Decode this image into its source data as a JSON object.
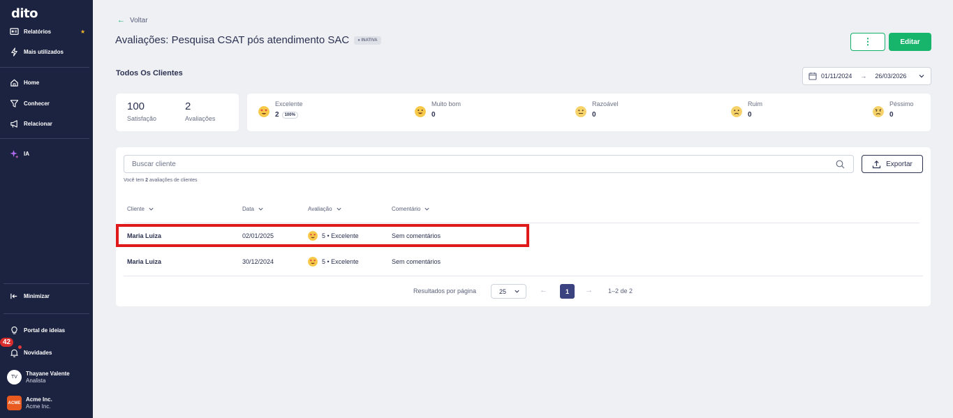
{
  "sidebar": {
    "logo": "dito",
    "items": {
      "relatorios": "Relatórios",
      "mais_utilizados": "Mais utilizados",
      "home": "Home",
      "conhecer": "Conhecer",
      "relacionar": "Relacionar",
      "ia": "IA",
      "minimizar": "Minimizar",
      "portal": "Portal de ideias",
      "novidades": "Novidades"
    },
    "favorite_star": "★",
    "notification_count": "42",
    "user": {
      "initials": "TV",
      "name": "Thayane Valente",
      "role": "Analista"
    },
    "company": {
      "logo_text": "ACME",
      "name": "Acme Inc.",
      "sub": "Acme Inc."
    }
  },
  "header": {
    "back_label": "Voltar",
    "title": "Avaliações: Pesquisa CSAT pós atendimento SAC",
    "status_badge": "● INATIVA",
    "more_button": "⋮",
    "edit_button": "Editar"
  },
  "filter": {
    "subtitle": "Todos Os Clientes",
    "date_start": "01/11/2024",
    "date_arrow": "→",
    "date_end": "26/03/2026"
  },
  "kpis": {
    "satisfacao_value": "100",
    "satisfacao_label": "Satisfação",
    "avaliacoes_value": "2",
    "avaliacoes_label": "Avaliações"
  },
  "ratings": [
    {
      "label": "Excelente",
      "value": "2",
      "pct": "100%",
      "icon": "heart-eyes-emoji-icon"
    },
    {
      "label": "Muito bom",
      "value": "0",
      "icon": "grin-emoji-icon"
    },
    {
      "label": "Razoável",
      "value": "0",
      "icon": "neutral-emoji-icon"
    },
    {
      "label": "Ruim",
      "value": "0",
      "icon": "frown-emoji-icon"
    },
    {
      "label": "Péssimo",
      "value": "0",
      "icon": "angry-emoji-icon"
    }
  ],
  "table": {
    "search_placeholder": "Buscar cliente",
    "export_label": "Exportar",
    "count_prefix": "Você tem ",
    "count_value": "2",
    "count_suffix": " avaliações de clientes",
    "columns": [
      "Cliente",
      "Data",
      "Avaliação",
      "Comentário"
    ],
    "rows": [
      {
        "cliente": "Maria Luiza",
        "data": "02/01/2025",
        "avaliacao": "5 • Excelente",
        "comentario": "Sem comentários"
      },
      {
        "cliente": "Maria Luiza",
        "data": "30/12/2024",
        "avaliacao": "5 • Excelente",
        "comentario": "Sem comentários"
      }
    ]
  },
  "pagination": {
    "per_page_label": "Resultados por página",
    "per_page_value": "25",
    "prev": "←",
    "current_page": "1",
    "next": "→",
    "range_info": "1–2 de 2"
  },
  "colors": {
    "sidebar_bg": "#1c2340",
    "accent_green": "#17b56c",
    "highlight_red": "#e01a1a",
    "page_active": "#3b4280"
  }
}
